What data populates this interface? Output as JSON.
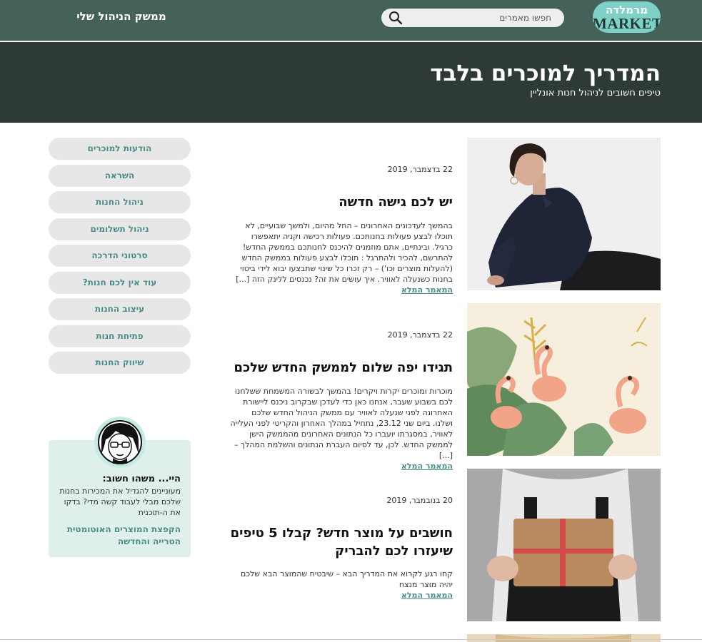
{
  "header": {
    "logo_hebrew": "מרמלדה",
    "logo_english": "MARKET",
    "search_placeholder": "חפשו מאמרים",
    "admin_link": "ממשק הניהול שלי"
  },
  "hero": {
    "title": "המדריך למוכרים בלבד",
    "subtitle": "טיפים חשובים לניהול חנות אונליין"
  },
  "articles": [
    {
      "date": "22 בדצמבר, 2019",
      "title": "יש לכם גישה חדשה",
      "excerpt": "בהמשך לעדכונים האחרונים – החל מהיום, ולמשך שבועיים, לא תוכלו לבצע פעולות בחנותכם. פעולות רכישה וקניה יתאפשרו כרגיל. ובינתיים, אתם מוזמנים להיכנס לחנותכם בממשק החדש! להתרשם, להכיר ולהתרגל : תוכלו לבצע פעולות בממשק החדש (להעלות מוצרים וכו') – רק זכרו כל שינוי שתבצעו יבוא לידי ביטוי בחנות כשנעלה לאוויר. איך עושים את זה? נכנסים ללינק הזה [...]",
      "read_more": "המאמר המלא"
    },
    {
      "date": "22 בדצמבר, 2019",
      "title": "תגידו יפה שלום לממשק החדש שלכם",
      "excerpt": "מוכרות ומוכרים יקרות ויקרים! בהמשך לבשורה המשמחת ששלחנו לכם בשבוע שעבר, אנחנו כאן כדי לעדכן שבקרוב ניכנס ליישורת האחרונה לפני שנעלה לאוויר עם ממשק הניהול החדש שלכם ושלנו. ביום שני 23.12, נתחיל במהלך האחרון והקריטי לפני העלייה לאוויר, במסגרתו יועברו כל הנתונים האחרונים מהממשק הישן לממשק החדש. לכן, עד לסיום העברת הנתונים והשלמת המהלך – [...]",
      "read_more": "המאמר המלא"
    },
    {
      "date": "20 בנובמבר, 2019",
      "title": "חושבים על מוצר חדש? קבלו 5 טיפים שיעזרו לכם להבריק",
      "excerpt": "קחו רגע לקרוא את המדריך הבא – שיבטיח שהמוצר הבא שלכם יהיה מוצר מנצח",
      "read_more": "המאמר המלא"
    }
  ],
  "sidebar": {
    "categories": [
      "הודעות למוכרים",
      "השראה",
      "ניהול החנות",
      "ניהול תשלומים",
      "סרטוני הדרכה",
      "עוד אין לכם חנות?",
      "עיצוב החנות",
      "פתיחת חנות",
      "שיווק החנות"
    ],
    "promo": {
      "heading": "היי... משהו חשוב:",
      "text": "מעוניינים להגדיל את המכירות בחנות שלכם מבלי לעבוד קשה מדי? בדקו את ה-תוכנית",
      "link": "הקפצת המוצרים האוטומטית הטרייה והחדשה"
    }
  },
  "colors": {
    "topbar": "#44615a",
    "hero": "#2e3a37",
    "accent": "#4a8e88",
    "logo_bg": "#7fd0c6",
    "pill_bg": "#e7e7e7",
    "promo_bg": "#dff0ec"
  },
  "icons": {
    "search": "search-icon",
    "avatar": "avatar-illustration"
  }
}
